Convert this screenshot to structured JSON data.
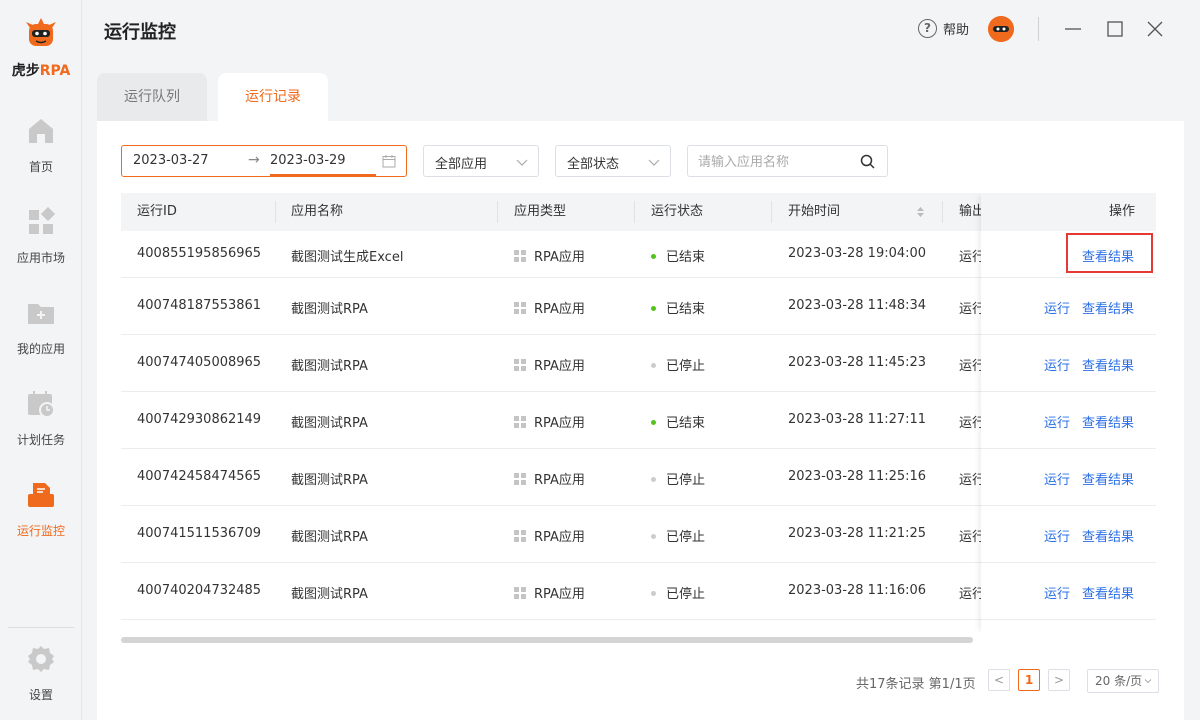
{
  "app": {
    "logo_cn": "虎步",
    "logo_rpa": "RPA"
  },
  "sidebar": {
    "items": [
      {
        "label": "首页",
        "icon": "home-icon"
      },
      {
        "label": "应用市场",
        "icon": "app-market-icon"
      },
      {
        "label": "我的应用",
        "icon": "my-apps-folder-icon"
      },
      {
        "label": "计划任务",
        "icon": "scheduled-task-calendar-icon"
      },
      {
        "label": "运行监控",
        "icon": "run-monitor-icon",
        "active": true
      }
    ],
    "settings_label": "设置"
  },
  "header": {
    "title": "运行监控",
    "help_label": "帮助"
  },
  "tabs": [
    {
      "label": "运行队列",
      "active": false
    },
    {
      "label": "运行记录",
      "active": true
    }
  ],
  "filters": {
    "date_start": "2023-03-27",
    "date_arrow": "→",
    "date_end": "2023-03-29",
    "app_select": "全部应用",
    "status_select": "全部状态",
    "search_placeholder": "请输入应用名称"
  },
  "table": {
    "columns": [
      "运行ID",
      "应用名称",
      "应用类型",
      "运行状态",
      "开始时间",
      "输出",
      "操作"
    ],
    "rows": [
      {
        "id": "400855195856965",
        "name": "截图测试生成Excel",
        "type": "RPA应用",
        "status": "已结束",
        "status_kind": "done",
        "start": "2023-03-28 19:04:00",
        "output": "运行",
        "actions": [
          "查看结果"
        ]
      },
      {
        "id": "400748187553861",
        "name": "截图测试RPA",
        "type": "RPA应用",
        "status": "已结束",
        "status_kind": "done",
        "start": "2023-03-28 11:48:34",
        "output": "运行",
        "actions": [
          "运行",
          "查看结果"
        ]
      },
      {
        "id": "400747405008965",
        "name": "截图测试RPA",
        "type": "RPA应用",
        "status": "已停止",
        "status_kind": "stopped",
        "start": "2023-03-28 11:45:23",
        "output": "运行",
        "actions": [
          "运行",
          "查看结果"
        ]
      },
      {
        "id": "400742930862149",
        "name": "截图测试RPA",
        "type": "RPA应用",
        "status": "已结束",
        "status_kind": "done",
        "start": "2023-03-28 11:27:11",
        "output": "运行",
        "actions": [
          "运行",
          "查看结果"
        ]
      },
      {
        "id": "400742458474565",
        "name": "截图测试RPA",
        "type": "RPA应用",
        "status": "已停止",
        "status_kind": "stopped",
        "start": "2023-03-28 11:25:16",
        "output": "运行",
        "actions": [
          "运行",
          "查看结果"
        ]
      },
      {
        "id": "400741511536709",
        "name": "截图测试RPA",
        "type": "RPA应用",
        "status": "已停止",
        "status_kind": "stopped",
        "start": "2023-03-28 11:21:25",
        "output": "运行",
        "actions": [
          "运行",
          "查看结果"
        ]
      },
      {
        "id": "400740204732485",
        "name": "截图测试RPA",
        "type": "RPA应用",
        "status": "已停止",
        "status_kind": "stopped",
        "start": "2023-03-28 11:16:06",
        "output": "运行",
        "actions": [
          "运行",
          "查看结果"
        ]
      }
    ]
  },
  "pagination": {
    "info": "共17条记录 第1/1页",
    "prev": "<",
    "current": "1",
    "next": ">",
    "page_size": "20 条/页"
  },
  "colors": {
    "accent": "#f06a1d",
    "link": "#2b6fe6",
    "status_done": "#52c41a",
    "status_stopped": "#cccccc",
    "highlight": "#e53935"
  }
}
